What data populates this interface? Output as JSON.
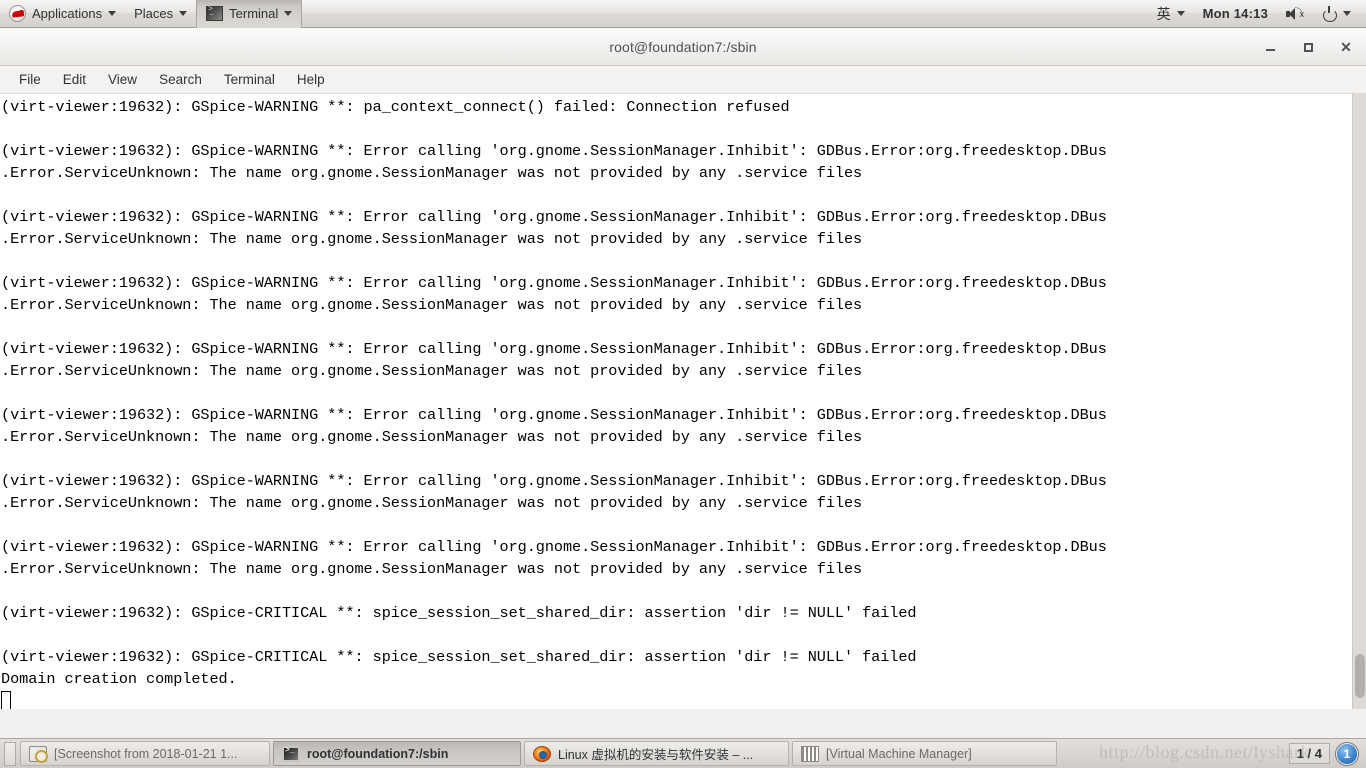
{
  "top_panel": {
    "applications_label": "Applications",
    "places_label": "Places",
    "terminal_label": "Terminal",
    "ime_label": "英",
    "clock": "Mon 14:13"
  },
  "window": {
    "title": "root@foundation7:/sbin",
    "menus": [
      "File",
      "Edit",
      "View",
      "Search",
      "Terminal",
      "Help"
    ]
  },
  "terminal": {
    "lines": [
      "(virt-viewer:19632): GSpice-WARNING **: pa_context_connect() failed: Connection refused",
      "",
      "(virt-viewer:19632): GSpice-WARNING **: Error calling 'org.gnome.SessionManager.Inhibit': GDBus.Error:org.freedesktop.DBus",
      ".Error.ServiceUnknown: The name org.gnome.SessionManager was not provided by any .service files",
      "",
      "(virt-viewer:19632): GSpice-WARNING **: Error calling 'org.gnome.SessionManager.Inhibit': GDBus.Error:org.freedesktop.DBus",
      ".Error.ServiceUnknown: The name org.gnome.SessionManager was not provided by any .service files",
      "",
      "(virt-viewer:19632): GSpice-WARNING **: Error calling 'org.gnome.SessionManager.Inhibit': GDBus.Error:org.freedesktop.DBus",
      ".Error.ServiceUnknown: The name org.gnome.SessionManager was not provided by any .service files",
      "",
      "(virt-viewer:19632): GSpice-WARNING **: Error calling 'org.gnome.SessionManager.Inhibit': GDBus.Error:org.freedesktop.DBus",
      ".Error.ServiceUnknown: The name org.gnome.SessionManager was not provided by any .service files",
      "",
      "(virt-viewer:19632): GSpice-WARNING **: Error calling 'org.gnome.SessionManager.Inhibit': GDBus.Error:org.freedesktop.DBus",
      ".Error.ServiceUnknown: The name org.gnome.SessionManager was not provided by any .service files",
      "",
      "(virt-viewer:19632): GSpice-WARNING **: Error calling 'org.gnome.SessionManager.Inhibit': GDBus.Error:org.freedesktop.DBus",
      ".Error.ServiceUnknown: The name org.gnome.SessionManager was not provided by any .service files",
      "",
      "(virt-viewer:19632): GSpice-WARNING **: Error calling 'org.gnome.SessionManager.Inhibit': GDBus.Error:org.freedesktop.DBus",
      ".Error.ServiceUnknown: The name org.gnome.SessionManager was not provided by any .service files",
      "",
      "(virt-viewer:19632): GSpice-CRITICAL **: spice_session_set_shared_dir: assertion 'dir != NULL' failed",
      "",
      "(virt-viewer:19632): GSpice-CRITICAL **: spice_session_set_shared_dir: assertion 'dir != NULL' failed",
      "Domain creation completed."
    ]
  },
  "taskbar": {
    "items": [
      {
        "label": "[Screenshot from 2018-01-21 1...",
        "icon": "screenshot-icon",
        "active": false,
        "dim": true
      },
      {
        "label": "root@foundation7:/sbin",
        "icon": "terminal-icon",
        "active": true,
        "dim": false
      },
      {
        "label": "Linux 虚拟机的安装与软件安装 – ...",
        "icon": "firefox-icon",
        "active": false,
        "dim": false
      },
      {
        "label": "[Virtual Machine Manager]",
        "icon": "virtual-machine-manager-icon",
        "active": false,
        "dim": true
      }
    ],
    "pager_label": "1 / 4",
    "workspace_badge": "1",
    "watermark": "http://blog.csdn.net/lyshark"
  }
}
